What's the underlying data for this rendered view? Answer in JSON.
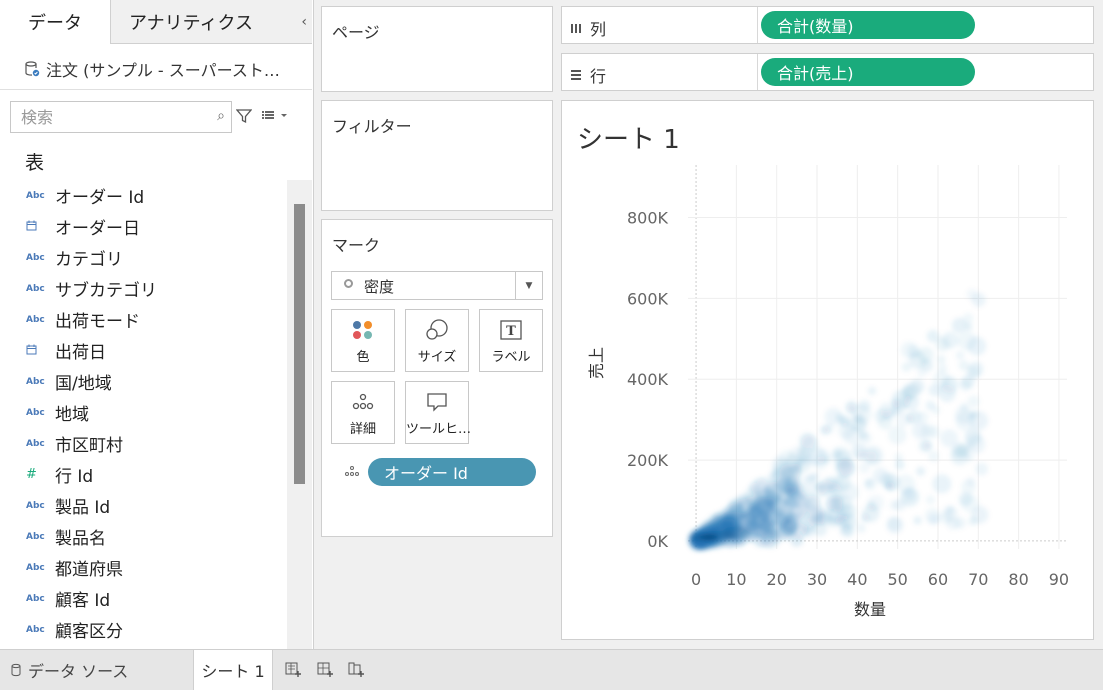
{
  "left_panel": {
    "tabs": [
      "データ",
      "アナリティクス"
    ],
    "collapse_glyph": "‹",
    "datasource": "注文 (サンプル - スーパースト…",
    "search": {
      "placeholder": "検索",
      "value": ""
    },
    "table_heading": "表",
    "fields": [
      {
        "icon": "Abc",
        "label": "オーダー Id"
      },
      {
        "icon": "date",
        "label": "オーダー日"
      },
      {
        "icon": "Abc",
        "label": "カテゴリ"
      },
      {
        "icon": "Abc",
        "label": "サブカテゴリ"
      },
      {
        "icon": "Abc",
        "label": "出荷モード"
      },
      {
        "icon": "date",
        "label": "出荷日"
      },
      {
        "icon": "Abc",
        "label": "国/地域"
      },
      {
        "icon": "Abc",
        "label": "地域"
      },
      {
        "icon": "Abc",
        "label": "市区町村"
      },
      {
        "icon": "#",
        "label": "行 Id"
      },
      {
        "icon": "Abc",
        "label": "製品 Id"
      },
      {
        "icon": "Abc",
        "label": "製品名"
      },
      {
        "icon": "Abc",
        "label": "都道府県"
      },
      {
        "icon": "Abc",
        "label": "顧客 Id"
      },
      {
        "icon": "Abc",
        "label": "顧客区分"
      }
    ]
  },
  "cards": {
    "pages": "ページ",
    "filters": "フィルター",
    "marks": {
      "title": "マーク",
      "mark_type": "密度",
      "buttons": [
        "色",
        "サイズ",
        "ラベル",
        "詳細",
        "ツールヒ…"
      ],
      "detail_pill": "オーダー Id"
    }
  },
  "shelves": {
    "columns": {
      "label": "列",
      "pill": "合計(数量)"
    },
    "rows": {
      "label": "行",
      "pill": "合計(売上)"
    }
  },
  "viz": {
    "sheet_title": "シート 1"
  },
  "chart_data": {
    "type": "density",
    "title": "シート 1",
    "xlabel": "数量",
    "ylabel": "売上",
    "x_ticks": [
      0,
      10,
      20,
      30,
      40,
      50,
      60,
      70,
      80,
      90
    ],
    "y_ticks": [
      "0K",
      "200K",
      "400K",
      "600K",
      "800K"
    ],
    "y_tick_values": [
      0,
      200000,
      400000,
      600000,
      800000
    ],
    "xlim": [
      -2,
      92
    ],
    "ylim": [
      -20000,
      930000
    ],
    "color": "#1f77b4",
    "grid": true
  },
  "bottom_bar": {
    "datasource_tab": "データ ソース",
    "sheet_tab": "シート 1"
  }
}
